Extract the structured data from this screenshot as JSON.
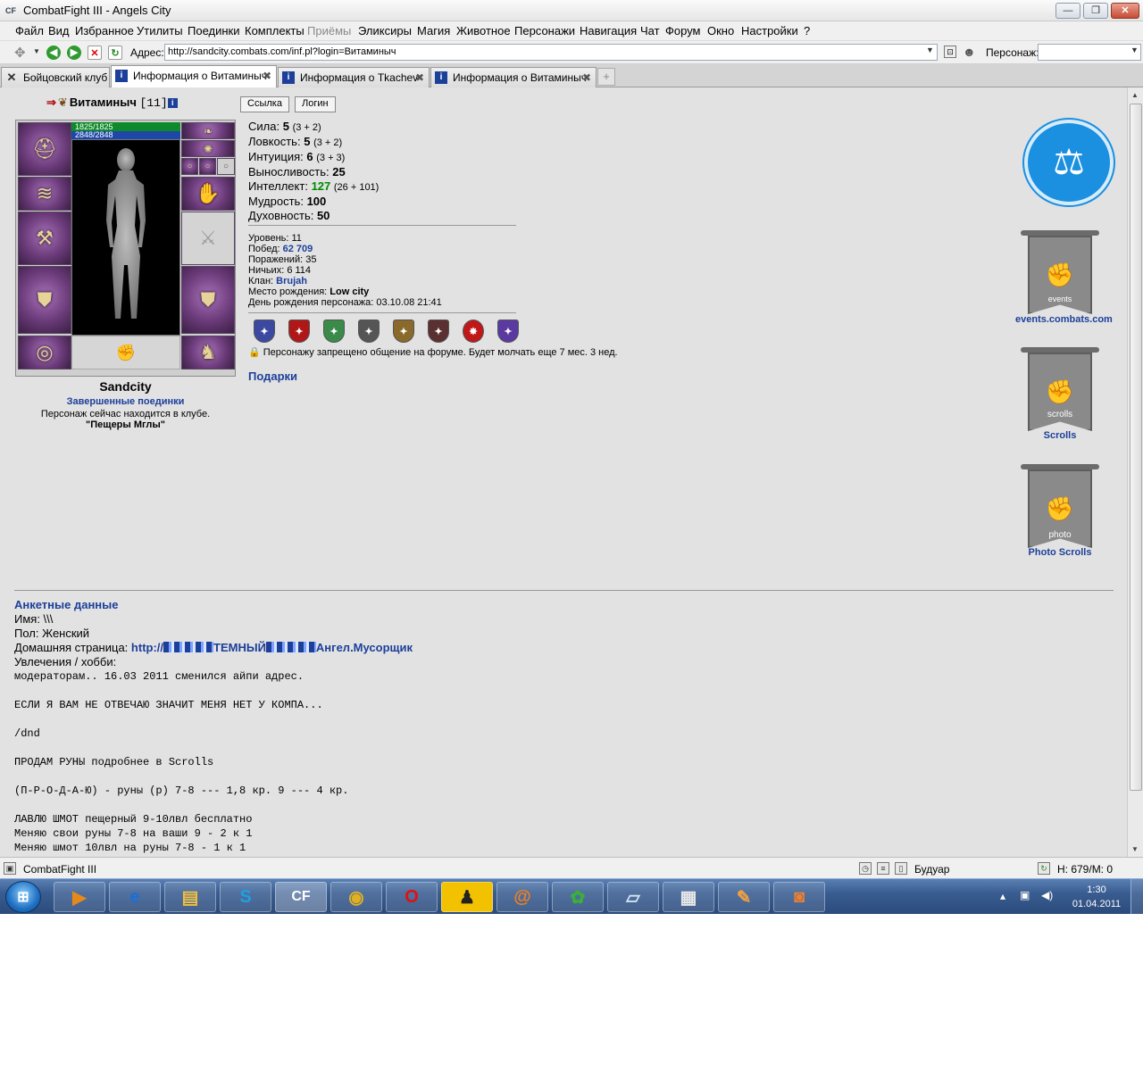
{
  "window": {
    "title": "CombatFight III - Angels City",
    "app_icon": "CF"
  },
  "menu": [
    "Файл",
    "Вид",
    "Избранное",
    "Утилиты",
    "Поединки",
    "Комплекты",
    "Приёмы",
    "Эликсиры",
    "Магия",
    "Животное",
    "Персонажи",
    "Навигация",
    "Чат",
    "Форум",
    "Окно",
    "Настройки",
    "?"
  ],
  "address": {
    "label": "Адрес:",
    "url": "http://sandcity.combats.com/inf.pl?login=Витаминыч",
    "persona_label": "Персонаж:"
  },
  "tabs": [
    {
      "label": "Бойцовский клуб",
      "icon": "crossed-swords-icon",
      "active": false
    },
    {
      "label": "Информация о Витаминыч",
      "icon": "info-icon",
      "active": true
    },
    {
      "label": "Информация о Tkachev",
      "icon": "info-icon",
      "active": false
    },
    {
      "label": "Информация о Витаминыч",
      "icon": "info-icon",
      "active": false
    }
  ],
  "character": {
    "name": "Витаминыч",
    "level": "[11]",
    "hp": "1825/1825",
    "mana": "2848/2848",
    "city": "Sandcity",
    "fights_link": "Завершенные поединки",
    "location_line1": "Персонаж сейчас находится в клубе.",
    "location_line2": "\"Пещеры Мглы\""
  },
  "buttons": {
    "link": "Ссылка",
    "login": "Логин"
  },
  "stats": [
    {
      "label": "Сила:",
      "value": "5",
      "detail": "(3 + 2)"
    },
    {
      "label": "Ловкость:",
      "value": "5",
      "detail": "(3 + 2)"
    },
    {
      "label": "Интуиция:",
      "value": "6",
      "detail": "(3 + 3)"
    },
    {
      "label": "Выносливость:",
      "value": "25",
      "detail": ""
    },
    {
      "label": "Интеллект:",
      "value": "127",
      "detail": "(26 + 101)"
    },
    {
      "label": "Мудрость:",
      "value": "100",
      "detail": ""
    },
    {
      "label": "Духовность:",
      "value": "50",
      "detail": ""
    }
  ],
  "info": {
    "level": {
      "label": "Уровень:",
      "value": "11"
    },
    "wins": {
      "label": "Побед:",
      "value": "62 709"
    },
    "losses": {
      "label": "Поражений:",
      "value": "35"
    },
    "draws": {
      "label": "Ничьих:",
      "value": "6 114"
    },
    "clan": {
      "label": "Клан:",
      "value": "Brujah"
    },
    "birthplace": {
      "label": "Место рождения:",
      "value": "Low city"
    },
    "birthday": {
      "label": "День рождения персонажа:",
      "value": "03.10.08 21:41"
    }
  },
  "medal_colors": [
    "#3b4aa0",
    "#b01818",
    "#3a8a4a",
    "#555555",
    "#8a6a2a",
    "#5a3030",
    "#c01818",
    "#5a3aa0"
  ],
  "ban_text": "Персонажу запрещено общение на форуме. Будет молчать еще 7 мес. 3 нед.",
  "gifts": "Подарки",
  "right_links": {
    "events": "events.combats.com",
    "events_banner_text": "events",
    "scrolls": "Scrolls",
    "scrolls_banner_text": "scrolls",
    "photo": "Photo Scrolls",
    "photo_banner_text": "photo"
  },
  "profile": {
    "title": "Анкетные данные",
    "name": "Имя: \\\\\\",
    "gender": "Пол: Женский",
    "homepage_label": "Домашняя страница:",
    "homepage_p1": "http://",
    "homepage_p2": "ТЕМНЫЙ",
    "homepage_p3": "Ангел.Мусорщик",
    "hobby_label": "Увлечения / хобби:",
    "lines": [
      "модераторам.. 16.03 2011 сменился айпи адрес.",
      "ЕСЛИ Я ВАМ НЕ ОТВЕЧАЮ ЗНАЧИТ МЕНЯ НЕТ У КОМПА...",
      "/dnd",
      "ПРОДАМ РУНЫ подробнее в Scrolls",
      "(П-Р-О-Д-А-Ю) - руны (р) 7-8 --- 1,8 кр. 9 --- 4 кр.",
      "ЛАВЛЮ ШМОТ пещерный 9-10лвл бесплатно",
      "Меняю свои руны 7-8 на ваши 9 - 2 к 1",
      "Меняю шмот 10лвл на руны 7-8 - 1 к 1"
    ]
  },
  "statusbar": {
    "app": "CombatFight III",
    "room": "Будуар",
    "counter": "Н: 679/М: 0"
  },
  "taskbar": {
    "time": "1:30",
    "date": "01.04.2011",
    "cf_label": "CF"
  }
}
